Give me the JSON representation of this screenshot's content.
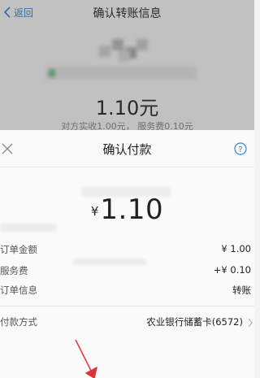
{
  "nav": {
    "back_label": "返回",
    "title": "确认转账信息"
  },
  "background": {
    "amount": "1.10元",
    "sub": "对方实收1.00元，  服务费0.10元"
  },
  "sheet": {
    "title": "确认付款",
    "currency": "¥",
    "amount": "1.10",
    "rows": [
      {
        "label": "订单金额",
        "value": "¥ 1.00"
      },
      {
        "label": "服务费",
        "value": "+¥ 0.10"
      },
      {
        "label": "订单信息",
        "value": "转账"
      }
    ],
    "payment": {
      "label": "付款方式",
      "value": "农业银行储蓄卡(6572)"
    }
  },
  "colors": {
    "link_blue": "#3c84d4",
    "annotation_red": "#e0333a"
  },
  "icons": {
    "back": "chevron-left-icon",
    "close": "close-icon",
    "help": "help-icon",
    "payment_more": "chevron-right-icon"
  }
}
